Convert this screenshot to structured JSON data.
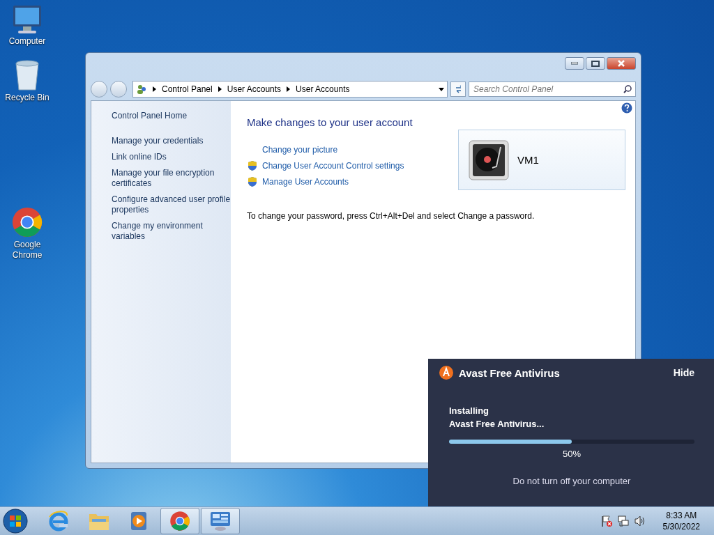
{
  "desktop_icons": [
    {
      "kind": "computer",
      "label": "Computer"
    },
    {
      "kind": "recycle",
      "label": "Recycle Bin"
    },
    {
      "kind": "chrome",
      "label": "Google Chrome"
    }
  ],
  "window": {
    "breadcrumb": [
      "Control Panel",
      "User Accounts",
      "User Accounts"
    ],
    "search": {
      "placeholder": "Search Control Panel"
    },
    "sidebar": {
      "home": "Control Panel Home",
      "links": [
        "Manage your credentials",
        "Link online IDs",
        "Manage your file encryption certificates",
        "Configure advanced user profile properties",
        "Change my environment variables"
      ]
    },
    "main": {
      "heading": "Make changes to your user account",
      "links": [
        {
          "label": "Change your picture",
          "shield": false
        },
        {
          "label": "Change User Account Control settings",
          "shield": true
        },
        {
          "label": "Manage User Accounts",
          "shield": true
        }
      ],
      "account_name": "VM1",
      "note": "To change your password, press Ctrl+Alt+Del and select Change a password."
    }
  },
  "popup": {
    "title": "Avast Free Antivirus",
    "hide": "Hide",
    "status": "Installing",
    "product": "Avast Free Antivirus...",
    "level": 0.5,
    "reading": "50%",
    "warning": "Do not turn off your computer"
  },
  "taskbar": {
    "apps": [
      {
        "kind": "ie",
        "active": false
      },
      {
        "kind": "explorer",
        "active": false
      },
      {
        "kind": "media",
        "active": false
      },
      {
        "kind": "chrome",
        "active": true
      },
      {
        "kind": "control",
        "active": true
      }
    ],
    "tray": [
      {
        "kind": "flag"
      },
      {
        "kind": "network"
      },
      {
        "kind": "speaker"
      }
    ],
    "time": "8:33 AM",
    "date": "5/30/2022"
  }
}
